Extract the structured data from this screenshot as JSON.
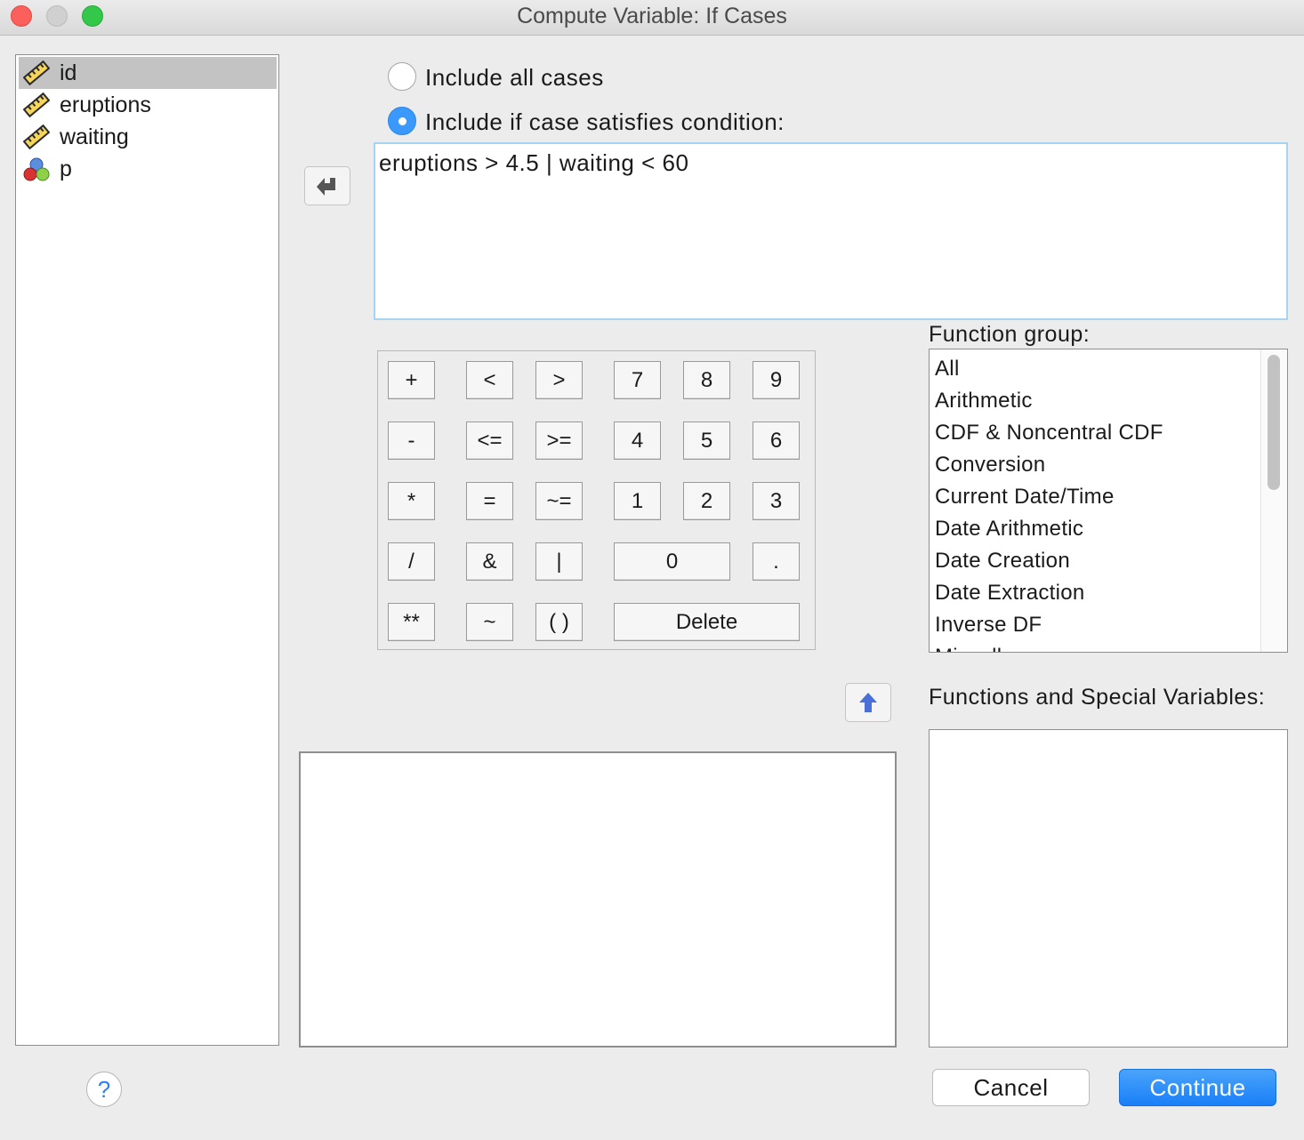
{
  "window": {
    "title": "Compute Variable: If Cases"
  },
  "variables": [
    {
      "name": "id",
      "type": "scale",
      "selected": true
    },
    {
      "name": "eruptions",
      "type": "scale",
      "selected": false
    },
    {
      "name": "waiting",
      "type": "scale",
      "selected": false
    },
    {
      "name": "p",
      "type": "nominal",
      "selected": false
    }
  ],
  "options": {
    "include_all_label": "Include all cases",
    "include_if_label": "Include if case satisfies condition:",
    "selected": "include_if"
  },
  "expression": "eruptions > 4.5 | waiting < 60",
  "keypad": {
    "plus": "+",
    "lt": "<",
    "gt": ">",
    "seven": "7",
    "eight": "8",
    "nine": "9",
    "minus": "-",
    "le": "<=",
    "ge": ">=",
    "four": "4",
    "five": "5",
    "six": "6",
    "mult": "*",
    "eq": "=",
    "ne": "~=",
    "one": "1",
    "two": "2",
    "three": "3",
    "div": "/",
    "and": "&",
    "or": "|",
    "zero": "0",
    "dot": ".",
    "pow": "**",
    "not": "~",
    "parens": "( )",
    "delete": "Delete"
  },
  "function_group": {
    "label": "Function group:",
    "items": [
      "All",
      "Arithmetic",
      "CDF & Noncentral CDF",
      "Conversion",
      "Current Date/Time",
      "Date Arithmetic",
      "Date Creation",
      "Date Extraction",
      "Inverse DF",
      "Miscellaneous"
    ]
  },
  "functions_label": "Functions and Special Variables:",
  "buttons": {
    "help": "?",
    "cancel": "Cancel",
    "continue": "Continue"
  },
  "colors": {
    "accent": "#1a7ff8",
    "selection": "#c3c3c3",
    "expr_border": "#a6d4f2"
  }
}
